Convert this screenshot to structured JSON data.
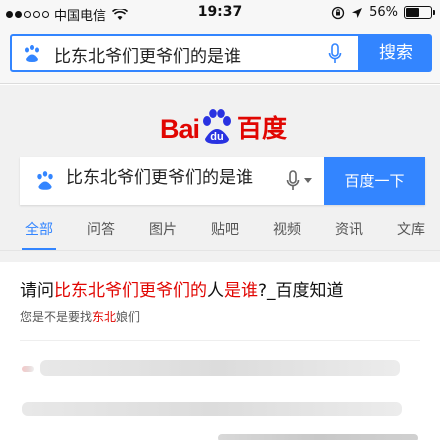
{
  "status_bar": {
    "carrier": "中国电信",
    "time": "19:37",
    "battery": "56%",
    "battery_level": 0.56
  },
  "top_search": {
    "query": "比东北爷们更爷们的是谁",
    "button_label": "搜索"
  },
  "logo": {
    "text_en": "Bai",
    "paw_text": "du",
    "text_cn": "百度"
  },
  "main_search": {
    "query": "比东北爷们更爷们的是谁",
    "button_label": "百度一下"
  },
  "tabs": [
    {
      "label": "全部",
      "active": true
    },
    {
      "label": "问答"
    },
    {
      "label": "图片"
    },
    {
      "label": "贴吧"
    },
    {
      "label": "视频"
    },
    {
      "label": "资讯"
    },
    {
      "label": "文库"
    }
  ],
  "result": {
    "title_parts": [
      "请问",
      "比东北爷们更爷们的",
      "人",
      "是谁",
      "?_百度知道"
    ],
    "sub_prefix": "您是不是要找",
    "sub_highlight": "东北",
    "sub_suffix": "娘们"
  },
  "colors": {
    "accent": "#3385ff",
    "brand_red": "#e10602"
  },
  "icons": [
    "paw-icon",
    "mic-icon",
    "wifi-icon",
    "location-icon",
    "lock-rotation-icon"
  ]
}
